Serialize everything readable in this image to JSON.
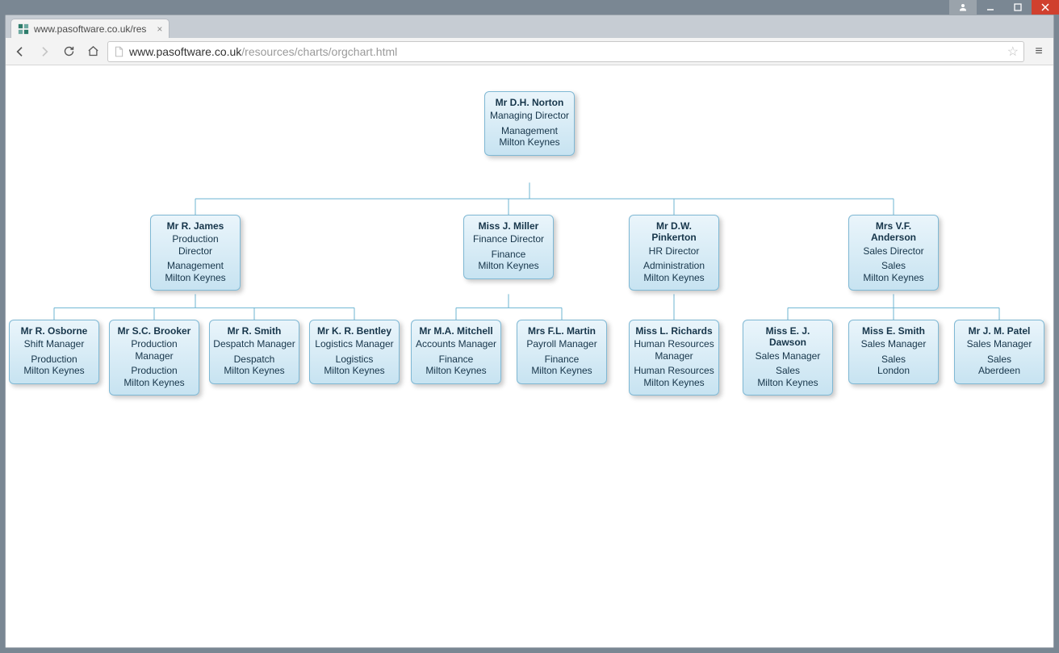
{
  "window": {
    "tab_title": "www.pasoftware.co.uk/res",
    "url_host": "www.pasoftware.co.uk",
    "url_path": "/resources/charts/orgchart.html"
  },
  "org": {
    "root": {
      "name": "Mr D.H. Norton",
      "title": "Managing Director",
      "dept": "Management",
      "loc": "Milton Keynes"
    },
    "level2": [
      {
        "name": "Mr R. James",
        "title": "Production Director",
        "dept": "Management",
        "loc": "Milton Keynes"
      },
      {
        "name": "Miss J. Miller",
        "title": "Finance Director",
        "dept": "Finance",
        "loc": "Milton Keynes"
      },
      {
        "name": "Mr D.W. Pinkerton",
        "title": "HR Director",
        "dept": "Administration",
        "loc": "Milton Keynes"
      },
      {
        "name": "Mrs V.F. Anderson",
        "title": "Sales Director",
        "dept": "Sales",
        "loc": "Milton Keynes"
      }
    ],
    "level3": [
      {
        "name": "Mr R. Osborne",
        "title": "Shift Manager",
        "dept": "Production",
        "loc": "Milton Keynes"
      },
      {
        "name": "Mr S.C. Brooker",
        "title": "Production Manager",
        "dept": "Production",
        "loc": "Milton Keynes"
      },
      {
        "name": "Mr R. Smith",
        "title": "Despatch Manager",
        "dept": "Despatch",
        "loc": "Milton Keynes"
      },
      {
        "name": "Mr K. R. Bentley",
        "title": "Logistics Manager",
        "dept": "Logistics",
        "loc": "Milton Keynes"
      },
      {
        "name": "Mr M.A. Mitchell",
        "title": "Accounts Manager",
        "dept": "Finance",
        "loc": "Milton Keynes"
      },
      {
        "name": "Mrs F.L. Martin",
        "title": "Payroll Manager",
        "dept": "Finance",
        "loc": "Milton Keynes"
      },
      {
        "name": "Miss L. Richards",
        "title": "Human Resources Manager",
        "dept": "Human Resources",
        "loc": "Milton Keynes"
      },
      {
        "name": "Miss E. J. Dawson",
        "title": "Sales Manager",
        "dept": "Sales",
        "loc": "Milton Keynes"
      },
      {
        "name": "Miss E. Smith",
        "title": "Sales Manager",
        "dept": "Sales",
        "loc": "London"
      },
      {
        "name": "Mr J. M. Patel",
        "title": "Sales Manager",
        "dept": "Sales",
        "loc": "Aberdeen"
      }
    ]
  },
  "chart_data": {
    "type": "orgchart",
    "root": {
      "name": "Mr D.H. Norton",
      "title": "Managing Director",
      "dept": "Management",
      "loc": "Milton Keynes",
      "children": [
        {
          "name": "Mr R. James",
          "title": "Production Director",
          "dept": "Management",
          "loc": "Milton Keynes",
          "children": [
            {
              "name": "Mr R. Osborne",
              "title": "Shift Manager",
              "dept": "Production",
              "loc": "Milton Keynes"
            },
            {
              "name": "Mr S.C. Brooker",
              "title": "Production Manager",
              "dept": "Production",
              "loc": "Milton Keynes"
            },
            {
              "name": "Mr R. Smith",
              "title": "Despatch Manager",
              "dept": "Despatch",
              "loc": "Milton Keynes"
            },
            {
              "name": "Mr K. R. Bentley",
              "title": "Logistics Manager",
              "dept": "Logistics",
              "loc": "Milton Keynes"
            }
          ]
        },
        {
          "name": "Miss J. Miller",
          "title": "Finance Director",
          "dept": "Finance",
          "loc": "Milton Keynes",
          "children": [
            {
              "name": "Mr M.A. Mitchell",
              "title": "Accounts Manager",
              "dept": "Finance",
              "loc": "Milton Keynes"
            },
            {
              "name": "Mrs F.L. Martin",
              "title": "Payroll Manager",
              "dept": "Finance",
              "loc": "Milton Keynes"
            }
          ]
        },
        {
          "name": "Mr D.W. Pinkerton",
          "title": "HR Director",
          "dept": "Administration",
          "loc": "Milton Keynes",
          "children": [
            {
              "name": "Miss L. Richards",
              "title": "Human Resources Manager",
              "dept": "Human Resources",
              "loc": "Milton Keynes"
            }
          ]
        },
        {
          "name": "Mrs V.F. Anderson",
          "title": "Sales Director",
          "dept": "Sales",
          "loc": "Milton Keynes",
          "children": [
            {
              "name": "Miss E. J. Dawson",
              "title": "Sales Manager",
              "dept": "Sales",
              "loc": "Milton Keynes"
            },
            {
              "name": "Miss E. Smith",
              "title": "Sales Manager",
              "dept": "Sales",
              "loc": "London"
            },
            {
              "name": "Mr J. M. Patel",
              "title": "Sales Manager",
              "dept": "Sales",
              "loc": "Aberdeen"
            }
          ]
        }
      ]
    }
  }
}
